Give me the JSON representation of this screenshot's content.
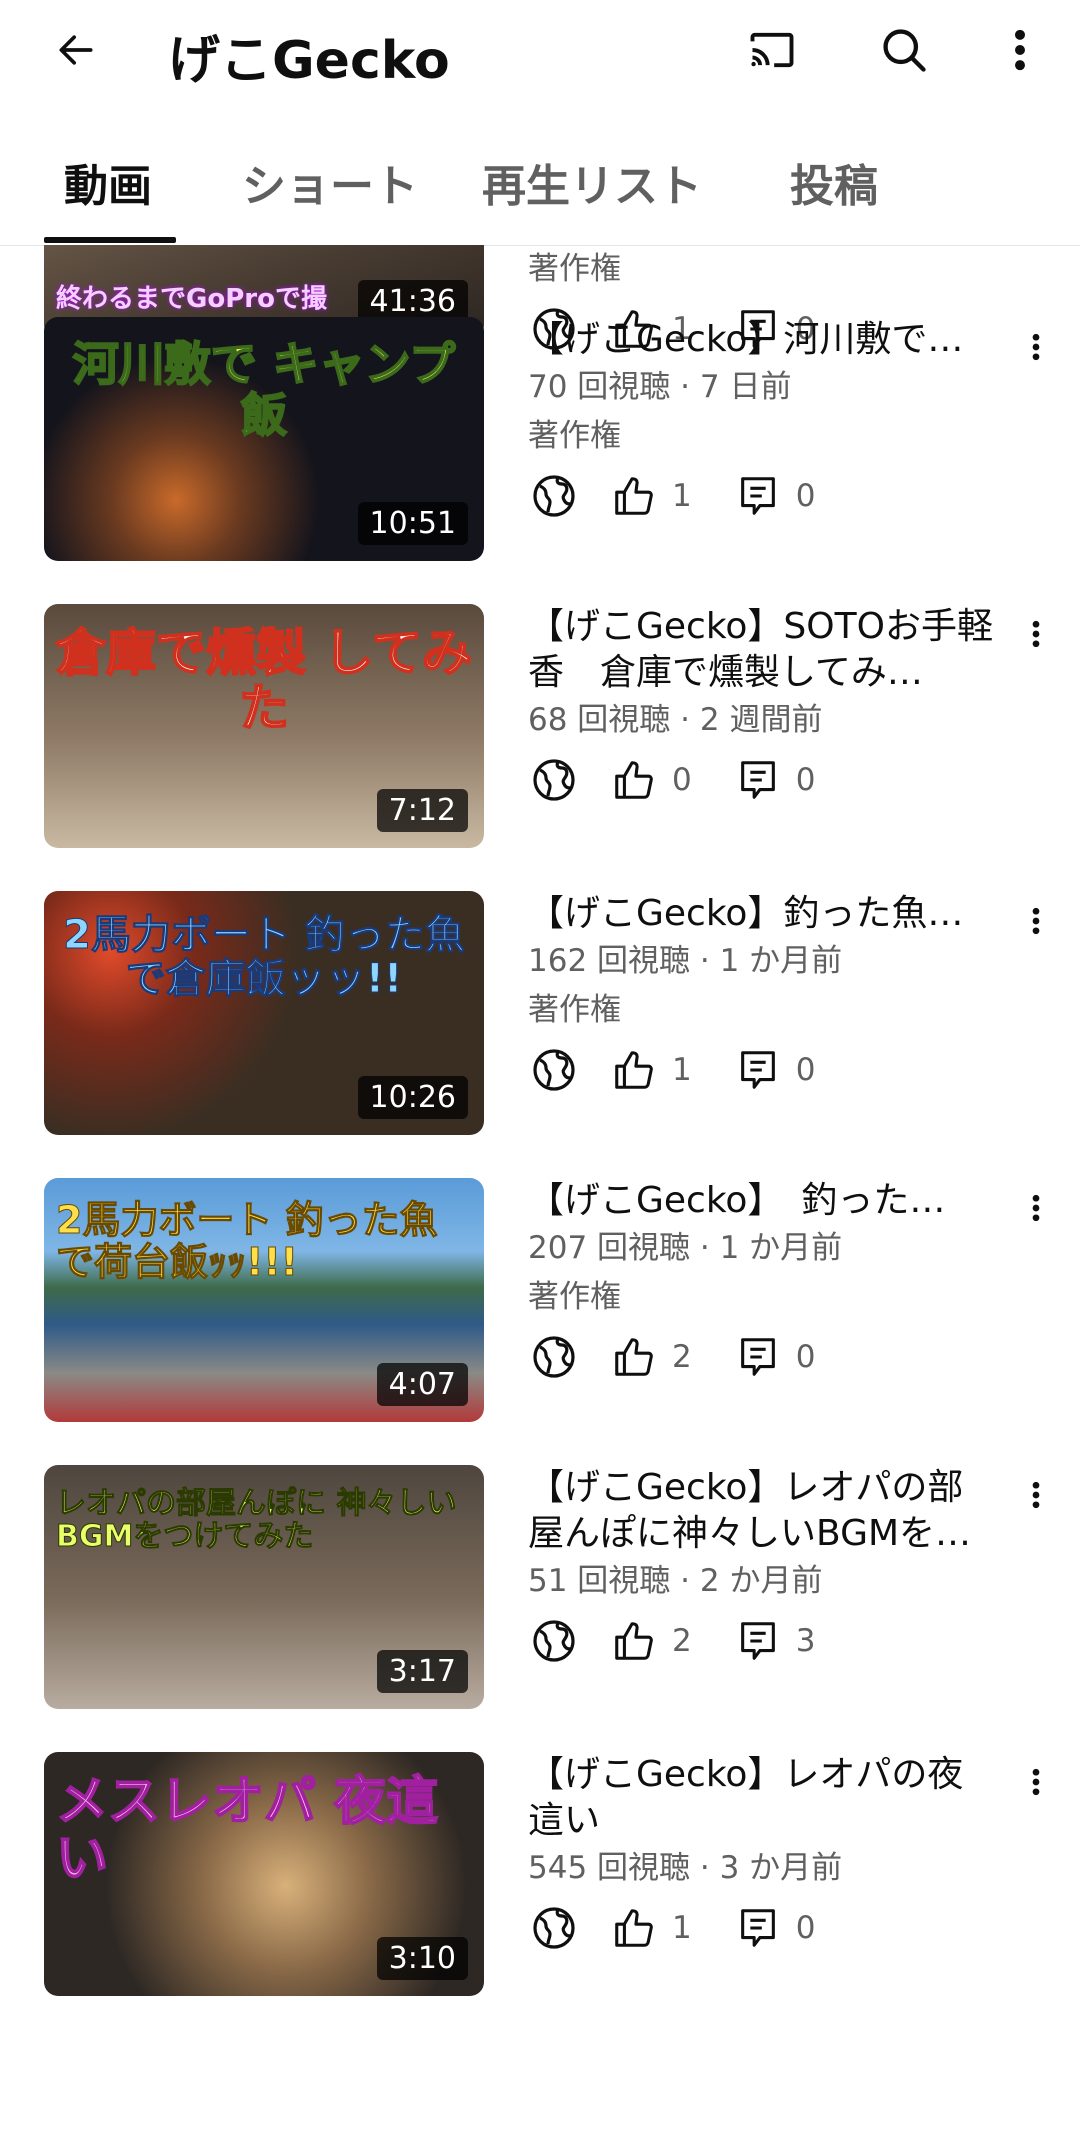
{
  "header": {
    "title": "げこGecko"
  },
  "tabs": [
    {
      "label": "動画",
      "active": true
    },
    {
      "label": "ショート",
      "active": false
    },
    {
      "label": "再生リスト",
      "active": false
    },
    {
      "label": "投稿",
      "active": false
    }
  ],
  "videos": [
    {
      "title": "",
      "views": "",
      "copyright": "著作権",
      "likes": "1",
      "comments": "0",
      "duration": "41:36",
      "thumb_caption": "終わるまでGoProで撮",
      "thumb_bg": "#6b5a4a"
    },
    {
      "title": "【げこGecko】河川敷で…",
      "views": "70 回視聴 · 7 日前",
      "copyright": "著作権",
      "likes": "1",
      "comments": "0",
      "duration": "10:51",
      "thumb_caption": "河川敷で キャンプ飯",
      "thumb_bg": "#1a1a22"
    },
    {
      "title": "【げこGecko】SOTOお手軽香　倉庫で燻製してみ…",
      "views": "68 回視聴 · 2 週間前",
      "copyright": "",
      "likes": "0",
      "comments": "0",
      "duration": "7:12",
      "thumb_caption": "倉庫で燻製 してみた",
      "thumb_bg": "#7a6a58"
    },
    {
      "title": "【げこGecko】釣った魚…",
      "views": "162 回視聴 · 1 か月前",
      "copyright": "著作権",
      "likes": "1",
      "comments": "0",
      "duration": "10:26",
      "thumb_caption": "2馬力ボート 釣った魚で倉庫飯ッッ!!",
      "thumb_bg": "#4a3a2a"
    },
    {
      "title": "【げこGecko】　釣った…",
      "views": "207 回視聴 · 1 か月前",
      "copyright": "著作権",
      "likes": "2",
      "comments": "0",
      "duration": "4:07",
      "thumb_caption": "2馬力ボート 釣った魚で荷台飯ｯｯ!!!",
      "thumb_bg": "#3a6fa8"
    },
    {
      "title": "【げこGecko】レオパの部屋んぽに神々しいBGMを…",
      "views": "51 回視聴 · 2 か月前",
      "copyright": "",
      "likes": "2",
      "comments": "3",
      "duration": "3:17",
      "thumb_caption": "レオパの部屋んぽに 神々しいBGMをつけてみた",
      "thumb_bg": "#5a5048"
    },
    {
      "title": "【げこGecko】レオパの夜這い",
      "views": "545 回視聴 · 3 か月前",
      "copyright": "",
      "likes": "1",
      "comments": "0",
      "duration": "3:10",
      "thumb_caption": "メスレオパ 夜這い",
      "thumb_bg": "#4a4038"
    }
  ],
  "colors": {
    "accent": "#0f0f0f",
    "secondary": "#606060"
  },
  "icons": [
    "back-icon",
    "cast-icon",
    "search-icon",
    "more-vert-icon",
    "globe-icon",
    "thumb-up-icon",
    "comment-icon"
  ]
}
